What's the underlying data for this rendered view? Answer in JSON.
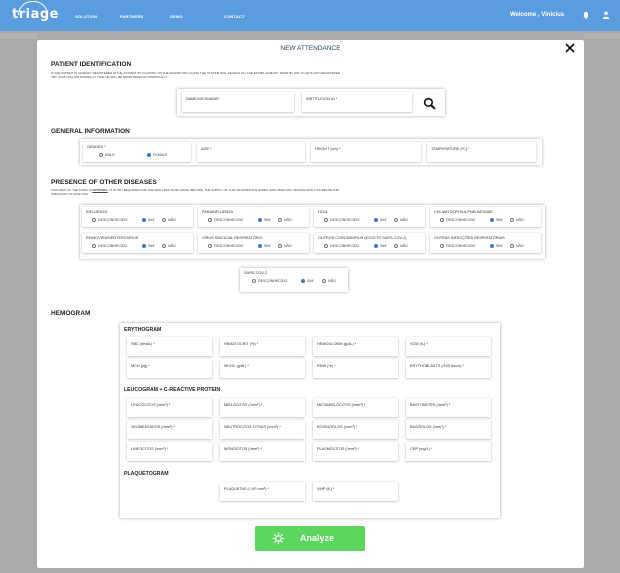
{
  "header": {
    "nav": [
      "SOLUTION",
      "PARTNERS",
      "DEMO",
      "CONTACT"
    ],
    "welcome": "Welcome , Vinicius",
    "logo_text": "triage"
  },
  "modal": {
    "title": "NEW ATTENDANCE",
    "patient_identification": {
      "heading": "PATIENT IDENTIFICATION",
      "note": "IF THE PATIENT IS ALREADY REGISTERED IN THE SYSTEM, BY CLICKING ON THE MAGNIFYING GLASS THE SYSTEM WILL SEARCH ALL THE EXAMS ALREADY DONE BY HIM. IF HE IS NOT REGISTERED YET, JUST FOLLOW NORMALLY THAT HE WILL BE REGISTERED AUTOMATICALLY.",
      "name_label": "NAME/NICKNAME*",
      "institution_label": "INSTITUTION ID *"
    },
    "general_information": {
      "heading": "GENERAL INFORMATION",
      "gender_label": "GENDER *",
      "male": "MALE",
      "female": "FEMALE",
      "age_label": "AGE  *",
      "height_label": "HEIGHT (cm) *",
      "temperature_label": "TEMPERATURE (ºC) *"
    },
    "diseases": {
      "heading": "PRESENCE OF OTHER DISEASES",
      "note_a": "THIS PART OF THE FORM IS ",
      "note_optional": "OPTIONAL",
      "note_b": ", IT IS NOT REQUIRED FOR THE ANALYZES TO BE MADE. BEFORE, THE SUPPLY OF THIS INFORMATION (WHEN AVAILABLE) MAY SIGNIFICANTLY INCREASE THE PRECISION OF ANALYSIS",
      "opt_unknown": "DESCONHECIDO",
      "opt_yes": "SIM",
      "opt_no": "NÃO",
      "items": [
        "INFLUENZA",
        "PARAINFLUENZA",
        "H1N1",
        "CHLAMYDOPHILA PNEUMONIAE",
        "RHINOVIRUS/ENTEROVIRUS",
        "VÍRUS SINCICIAL RESPIRATÓRIO",
        "OUTROS CORONAVÍRUS (EXCETO SARS-COV-2)",
        "OUTRAS INFECÇÕES RESPIRATÓRIAS"
      ],
      "sars_label": "SARS-COV-2"
    },
    "hemogram": {
      "heading": "HEMOGRAM",
      "erythogram": "ERYTHOGRAM",
      "ery_fields": [
        "RBC  (tera/L) *",
        "HEMATOCRIT (%) *",
        "HEMOGLOBIN (g/dL) *",
        "VCM (fL) *",
        "MCH (pg) *",
        "MCHC (g/dL) *",
        "RDW (%) *",
        "ERYTHOBLASTS (/100 leuco) *"
      ],
      "leucogram": "LEUCOGRAM + C-REACTIVE PROTEIN",
      "leu_fields": [
        "LEUCÓCITOS (/mm³) *",
        "MIELÓCITOS (/mm³) *",
        "METAMIELÓCITOS (/mm³) *",
        "BASTONETES (/mm³) *",
        "SEGMENTADOS (/mm³) *",
        "NEUTRÓCITOS TOTAIS (/mm³) *",
        "EOSINÓFILOS (/mm³) *",
        "BASÓFILOS (/mm³) *",
        "LINFÓCITOS (/mm³) *",
        "MONÓCITOS (/mm³) *",
        "PLASMÓCITOS (/mm³) *",
        "CRP (mg/L) *"
      ],
      "plaquetogram": "PLAQUETOGRAM",
      "plq_fields": [
        "PLAQUETAS (/ 10³ mm³) *",
        "VMP (fL) *"
      ]
    },
    "analyze_label": "Analyze"
  },
  "colors": {
    "header": "#5a9ddf",
    "analyze": "#5cd65c",
    "radio_on": "#3b78d0",
    "title": "#2a3c6b"
  }
}
